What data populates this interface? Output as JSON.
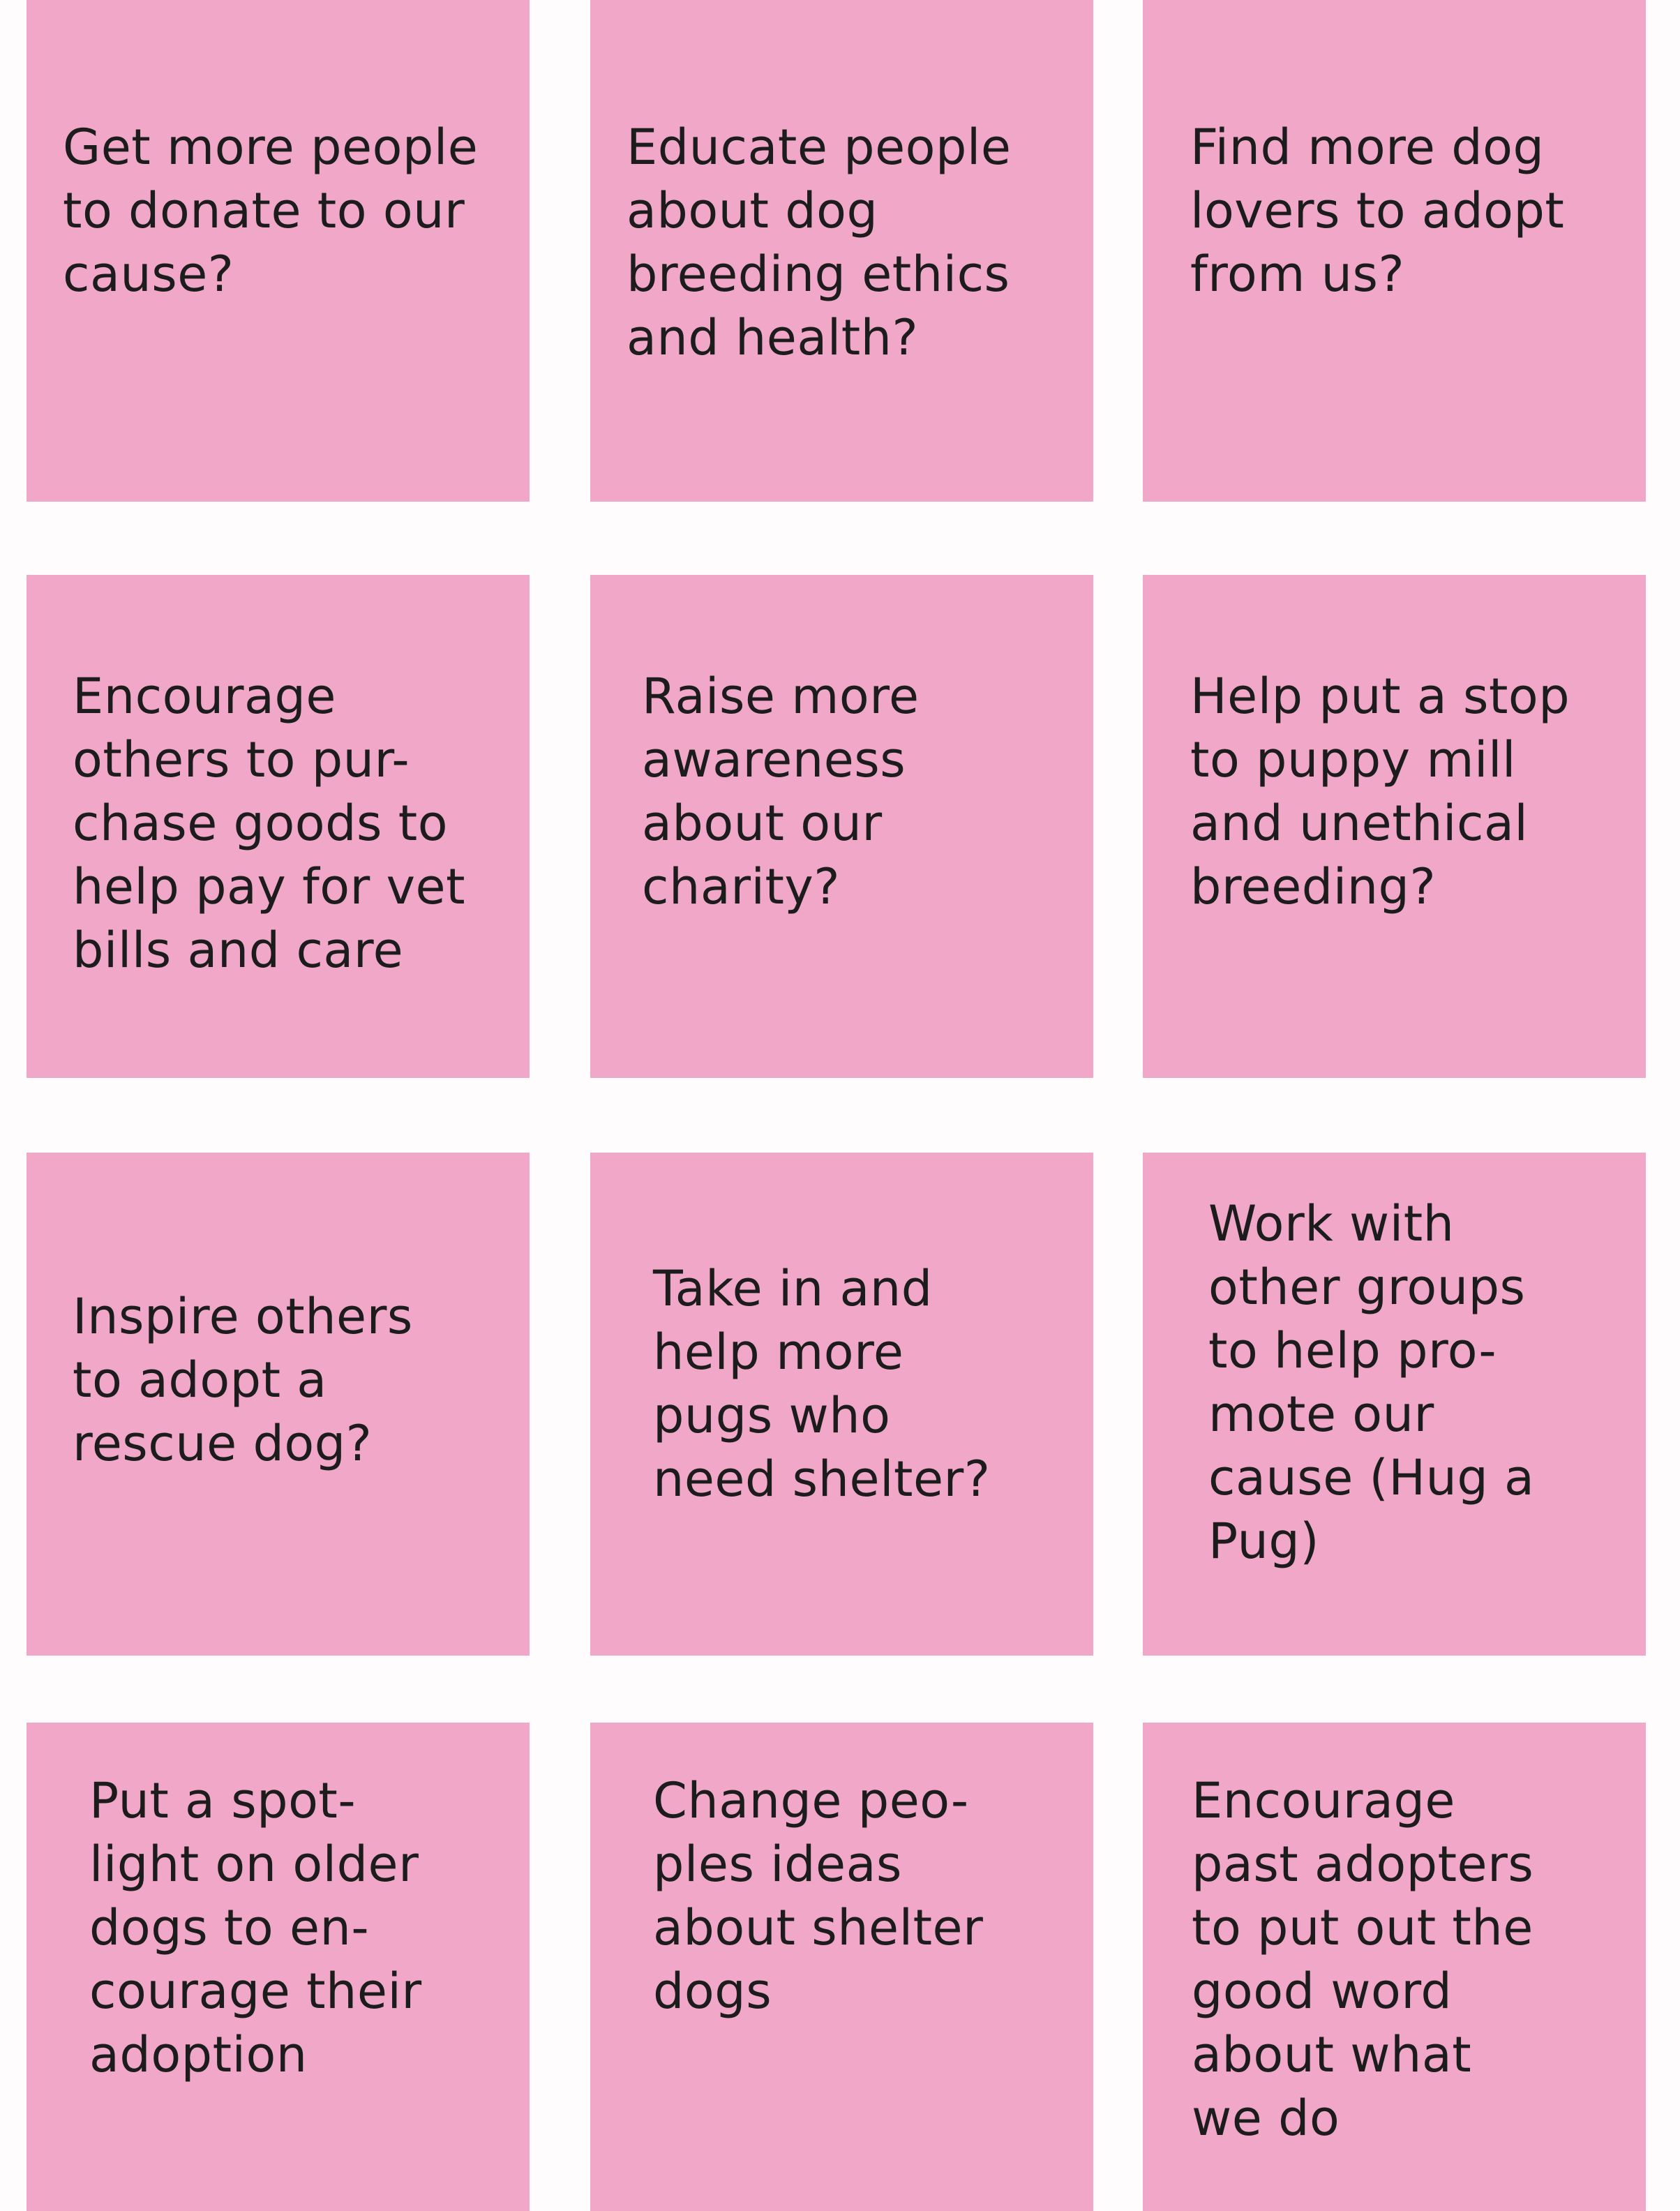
{
  "board": {
    "notes": [
      {
        "text": "Get more people\nto donate to our\ncause?"
      },
      {
        "text": "Educate people\nabout dog\nbreeding ethics\nand health?"
      },
      {
        "text": "Find more dog\nlovers to adopt\nfrom us?"
      },
      {
        "text": "Encourage\nothers to pur-\nchase goods to\nhelp pay for vet\nbills and care"
      },
      {
        "text": "Raise more\nawareness\nabout our\ncharity?"
      },
      {
        "text": "Help put a stop\nto puppy mill\nand unethical\nbreeding?"
      },
      {
        "text": "Inspire others\nto adopt a\nrescue dog?"
      },
      {
        "text": "Take in and\nhelp more\npugs who\nneed shelter?"
      },
      {
        "text": "Work with\nother groups\nto help pro-\nmote our\ncause (Hug a\nPug)"
      },
      {
        "text": "Put a spot-\nlight on older\ndogs to en-\ncourage their\nadoption"
      },
      {
        "text": "Change peo-\nples ideas\nabout shelter\ndogs"
      },
      {
        "text": "Encourage\npast adopters\nto put out the\ngood word\nabout what\nwe do"
      }
    ],
    "colors": {
      "note": "#f0a7c8",
      "text": "#1c1c1c",
      "background": "#fefcfd"
    }
  }
}
